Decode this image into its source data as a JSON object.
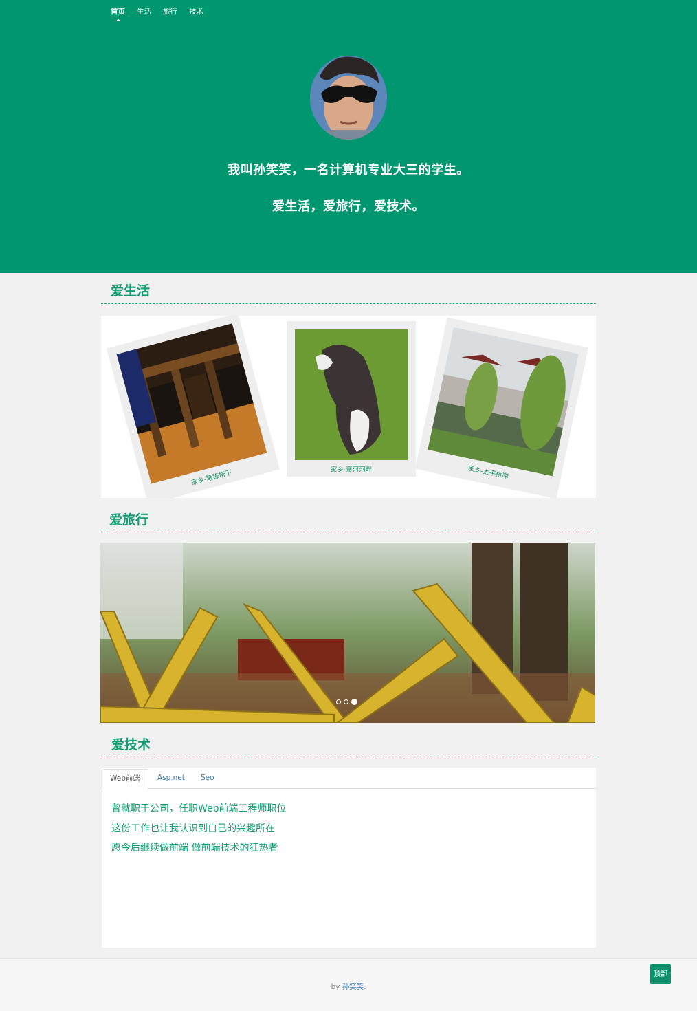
{
  "nav": {
    "items": [
      "首页",
      "生活",
      "旅行",
      "技术"
    ],
    "active": "首页"
  },
  "hero": {
    "line1": "我叫孙笑笑，一名计算机专业大三的学生。",
    "line2": "爱生活，爱旅行，爱技术。",
    "background": "#009670"
  },
  "life": {
    "title": "爱生活",
    "photos": [
      {
        "caption": "家乡-笔锋塔下"
      },
      {
        "caption": "家乡-襄河河畔"
      },
      {
        "caption": "家乡-太平桥岸"
      }
    ]
  },
  "travel": {
    "title": "爱旅行",
    "slide_count": 3,
    "active_slide": 3
  },
  "tech": {
    "title": "爱技术",
    "tabs": [
      "Web前端",
      "Asp.net",
      "Seo"
    ],
    "active_tab": "Web前端",
    "lines": [
      "曾就职于公司，任职Web前端工程师职位",
      "这份工作也让我认识到自己的兴趣所在",
      "愿今后继续做前端 做前端技术的狂热者"
    ]
  },
  "footer": {
    "by_prefix": "by ",
    "author": "孙笑笑."
  },
  "back_to_top": "顶部",
  "colors": {
    "accent": "#009670",
    "heading": "#139f73",
    "link": "#337ab7"
  }
}
